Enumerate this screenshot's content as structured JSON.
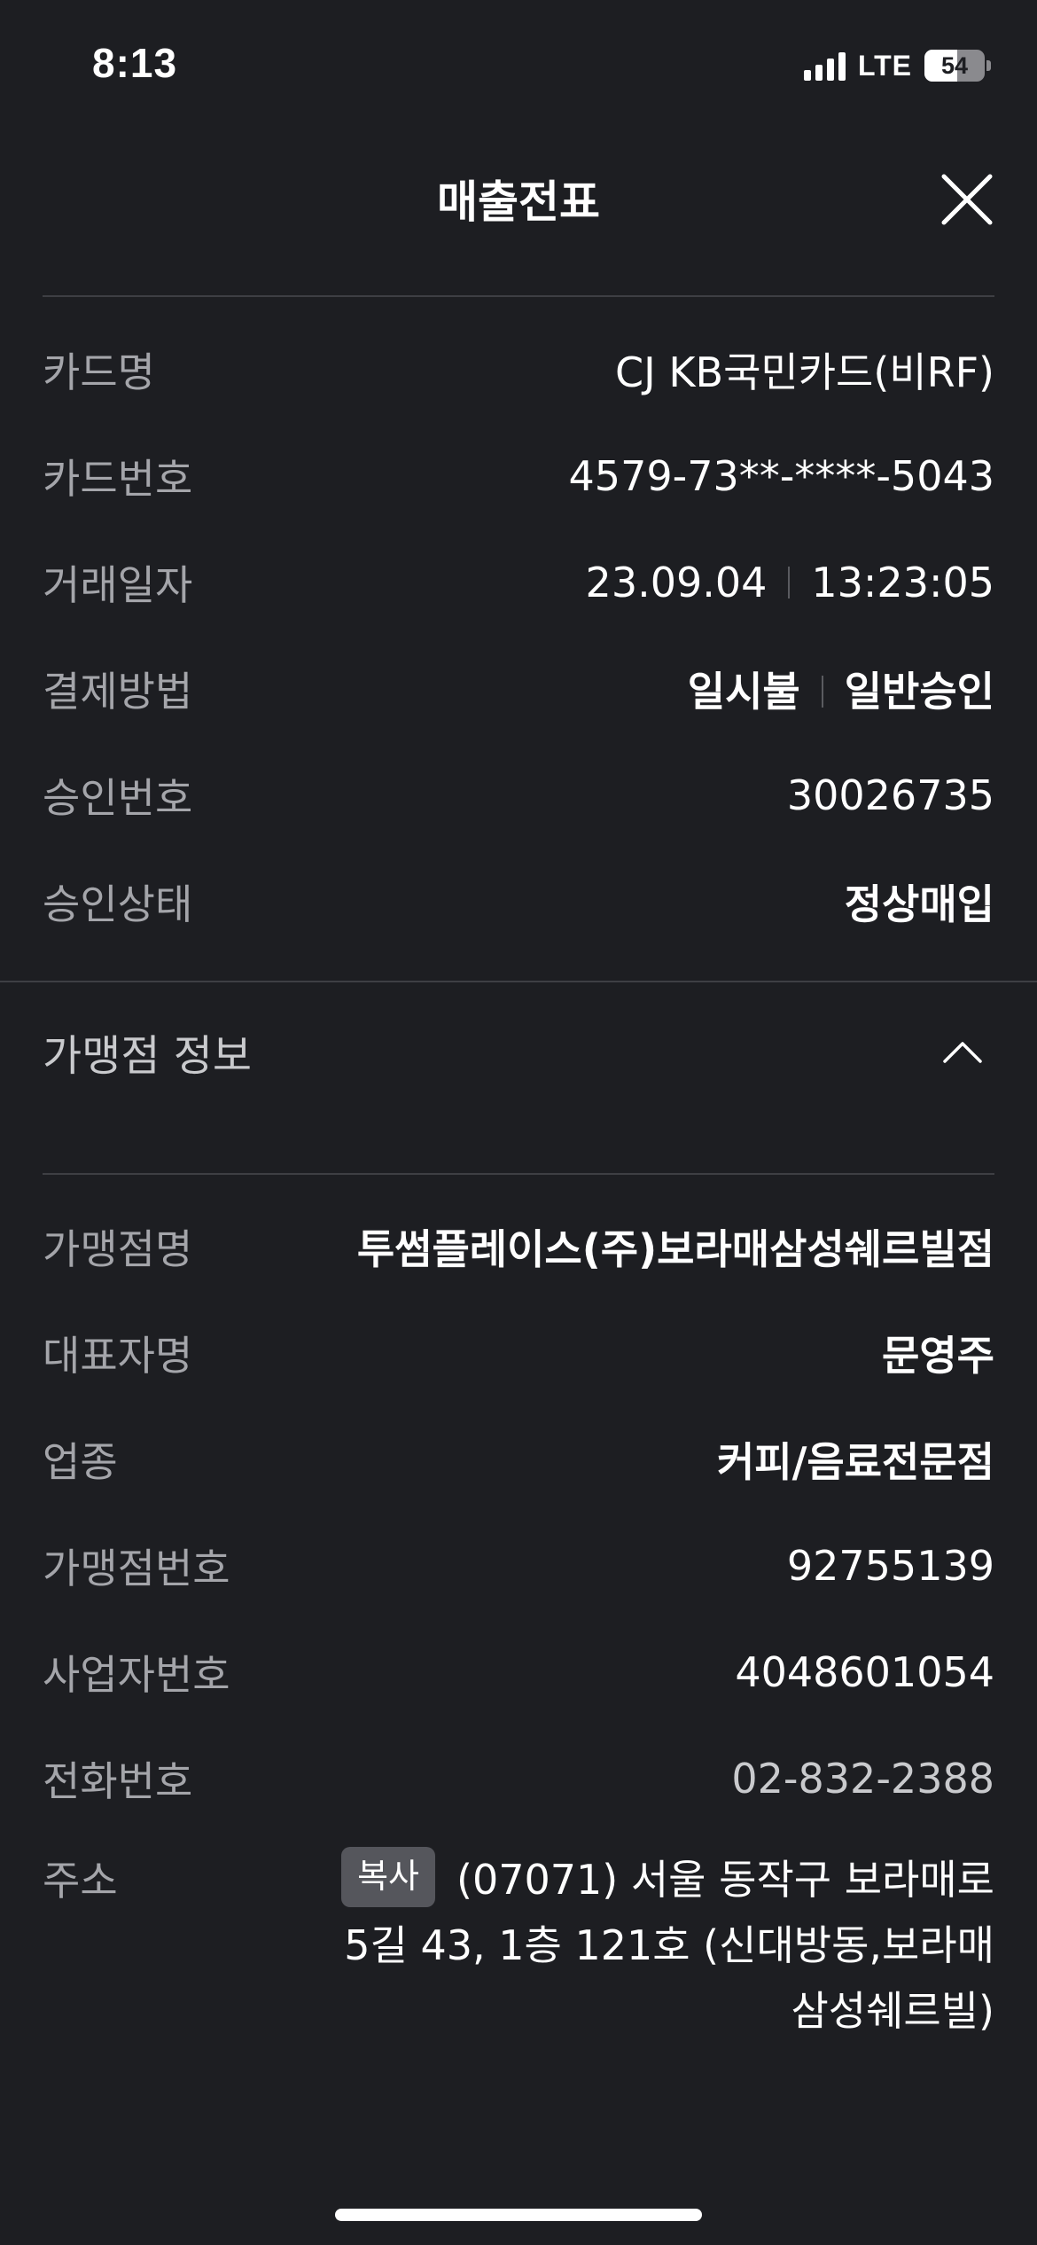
{
  "status_bar": {
    "time": "8:13",
    "network": "LTE",
    "battery_level": "54",
    "battery_fraction": 0.54
  },
  "header": {
    "title": "매출전표",
    "close_icon": "close-icon"
  },
  "transaction": {
    "card_name_label": "카드명",
    "card_name": "CJ KB국민카드(비RF)",
    "card_number_label": "카드번호",
    "card_number": "4579-73**-****-5043",
    "date_label": "거래일자",
    "date": "23.09.04",
    "time": "13:23:05",
    "payment_label": "결제방법",
    "payment_type": "일시불",
    "payment_approval": "일반승인",
    "approval_number_label": "승인번호",
    "approval_number": "30026735",
    "approval_status_label": "승인상태",
    "approval_status": "정상매입"
  },
  "merchant_section": {
    "title": "가맹점 정보",
    "expanded": true,
    "chevron_icon": "chevron-up-icon"
  },
  "merchant": {
    "name_label": "가맹점명",
    "name": "투썸플레이스(주)보라매삼성쉐르빌점",
    "owner_label": "대표자명",
    "owner": "문영주",
    "business_type_label": "업종",
    "business_type": "커피/음료전문점",
    "merchant_number_label": "가맹점번호",
    "merchant_number": "92755139",
    "business_number_label": "사업자번호",
    "business_number": "4048601054",
    "phone_label": "전화번호",
    "phone": "02-832-2388",
    "address_label": "주소",
    "copy_label": "복사",
    "address_line1": "(07071) 서울 동작구 보라매로",
    "address_line2": "5길 43, 1층 121호 (신대방동,보라매",
    "address_line3": "삼성쉐르빌)"
  },
  "colors": {
    "background": "#1d1e22",
    "label": "#a4a5aa",
    "value": "#ffffff",
    "divider": "#3e3f44",
    "copy_button": "#55565c"
  }
}
